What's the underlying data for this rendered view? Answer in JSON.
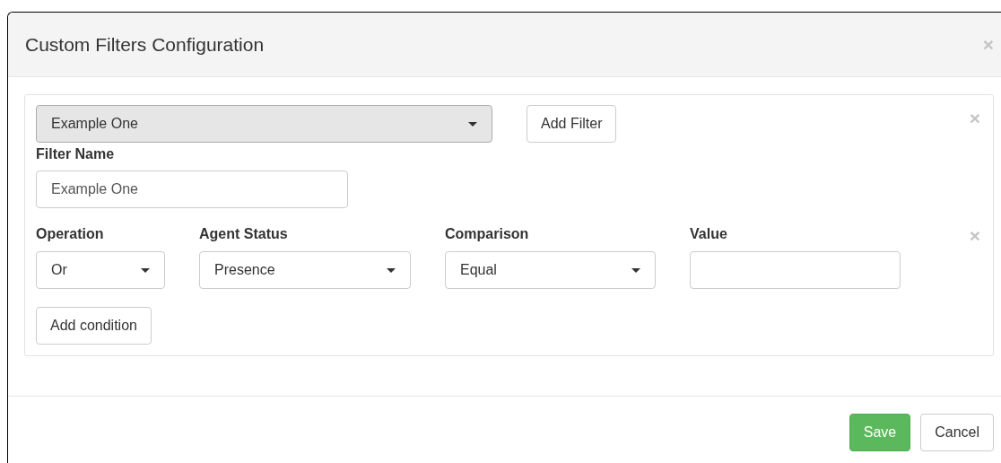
{
  "dialog": {
    "title": "Custom Filters Configuration",
    "close": "×"
  },
  "filter_select": {
    "value": "Example One"
  },
  "add_filter_button": "Add Filter",
  "remove_filter": "×",
  "filter_name": {
    "label": "Filter Name",
    "value": "Example One"
  },
  "condition": {
    "remove": "×",
    "fields": [
      {
        "kind": "select",
        "label": "Operation",
        "value": "Or"
      },
      {
        "kind": "select",
        "label": "Agent Status",
        "value": "Presence"
      },
      {
        "kind": "select",
        "label": "Comparison",
        "value": "Equal"
      },
      {
        "kind": "input",
        "label": "Value"
      }
    ]
  },
  "add_condition_button": "Add condition",
  "footer_buttons": [
    {
      "kind": "primary",
      "label": "Save"
    },
    {
      "kind": "default",
      "label": "Cancel"
    }
  ]
}
